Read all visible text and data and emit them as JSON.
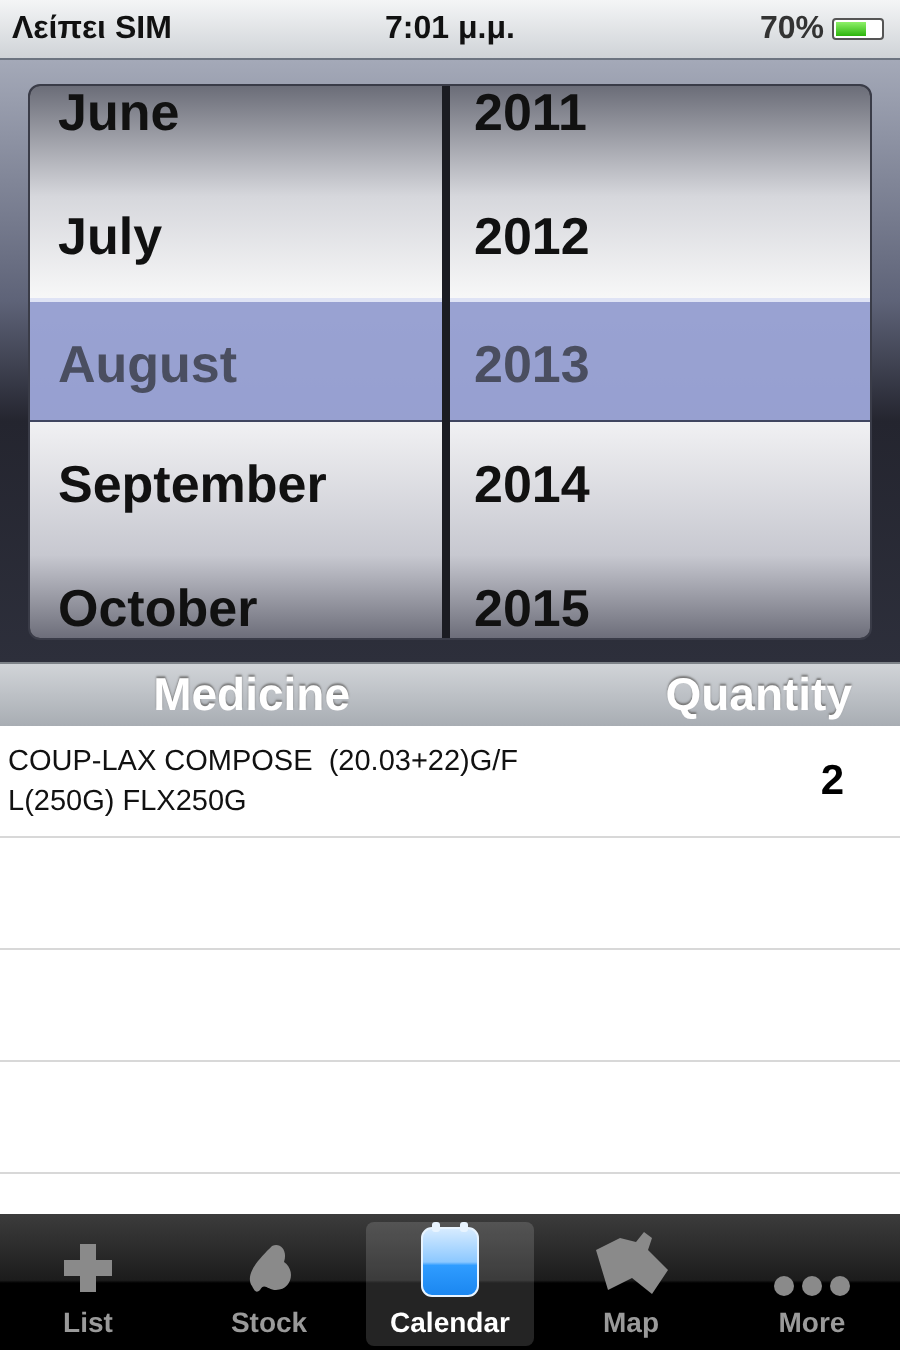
{
  "status_bar": {
    "carrier": "Λείπει SIM",
    "time": "7:01 μ.μ.",
    "battery": "70%"
  },
  "picker": {
    "columns": [
      {
        "items": [
          {
            "label": "June",
            "selected": false
          },
          {
            "label": "July",
            "selected": false
          },
          {
            "label": "August",
            "selected": true
          },
          {
            "label": "September",
            "selected": false
          },
          {
            "label": "October",
            "selected": false
          }
        ]
      },
      {
        "items": [
          {
            "label": "2011",
            "selected": false
          },
          {
            "label": "2012",
            "selected": false
          },
          {
            "label": "2013",
            "selected": true
          },
          {
            "label": "2014",
            "selected": false
          },
          {
            "label": "2015",
            "selected": false
          }
        ]
      }
    ]
  },
  "table": {
    "columns": [
      "Medicine",
      "Quantity"
    ],
    "rows": [
      {
        "medicine": "COUP-LAX COMPOSE  (20.03+22)G/F L(250G) FLX250G",
        "quantity": "2"
      }
    ]
  },
  "tab_bar": [
    {
      "label": "List",
      "selected": false
    },
    {
      "label": "Stock",
      "selected": false
    },
    {
      "label": "Calendar",
      "selected": true
    },
    {
      "label": "Map",
      "selected": false
    },
    {
      "label": "More",
      "selected": false
    }
  ]
}
